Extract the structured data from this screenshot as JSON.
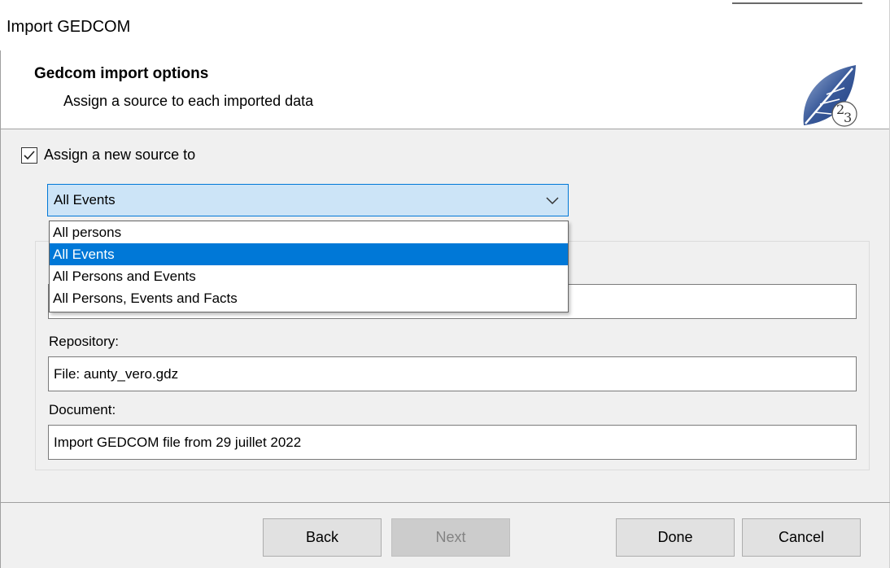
{
  "window": {
    "title": "Import GEDCOM"
  },
  "header": {
    "heading": "Gedcom import options",
    "subheading": "Assign a source to each imported data"
  },
  "options": {
    "assign_checkbox_label": "Assign a new source to",
    "assign_checked": true,
    "scope_selected": "All Events",
    "scope_options": [
      "All persons",
      "All Events",
      "All Persons and Events",
      "All Persons, Events and Facts"
    ]
  },
  "fields": {
    "repository_label": "Repository:",
    "repository_value": "File: aunty_vero.gdz",
    "document_label": "Document:",
    "document_value": "Import GEDCOM file from 29 juillet 2022"
  },
  "buttons": {
    "back": "Back",
    "next": "Next",
    "done": "Done",
    "cancel": "Cancel"
  },
  "colors": {
    "accent": "#0078d7",
    "combo_highlight": "#cce4f7"
  },
  "icons": {
    "logo": "leaf-23-logo-icon",
    "checkbox": "checkmark-icon",
    "combo": "chevron-down-icon"
  }
}
